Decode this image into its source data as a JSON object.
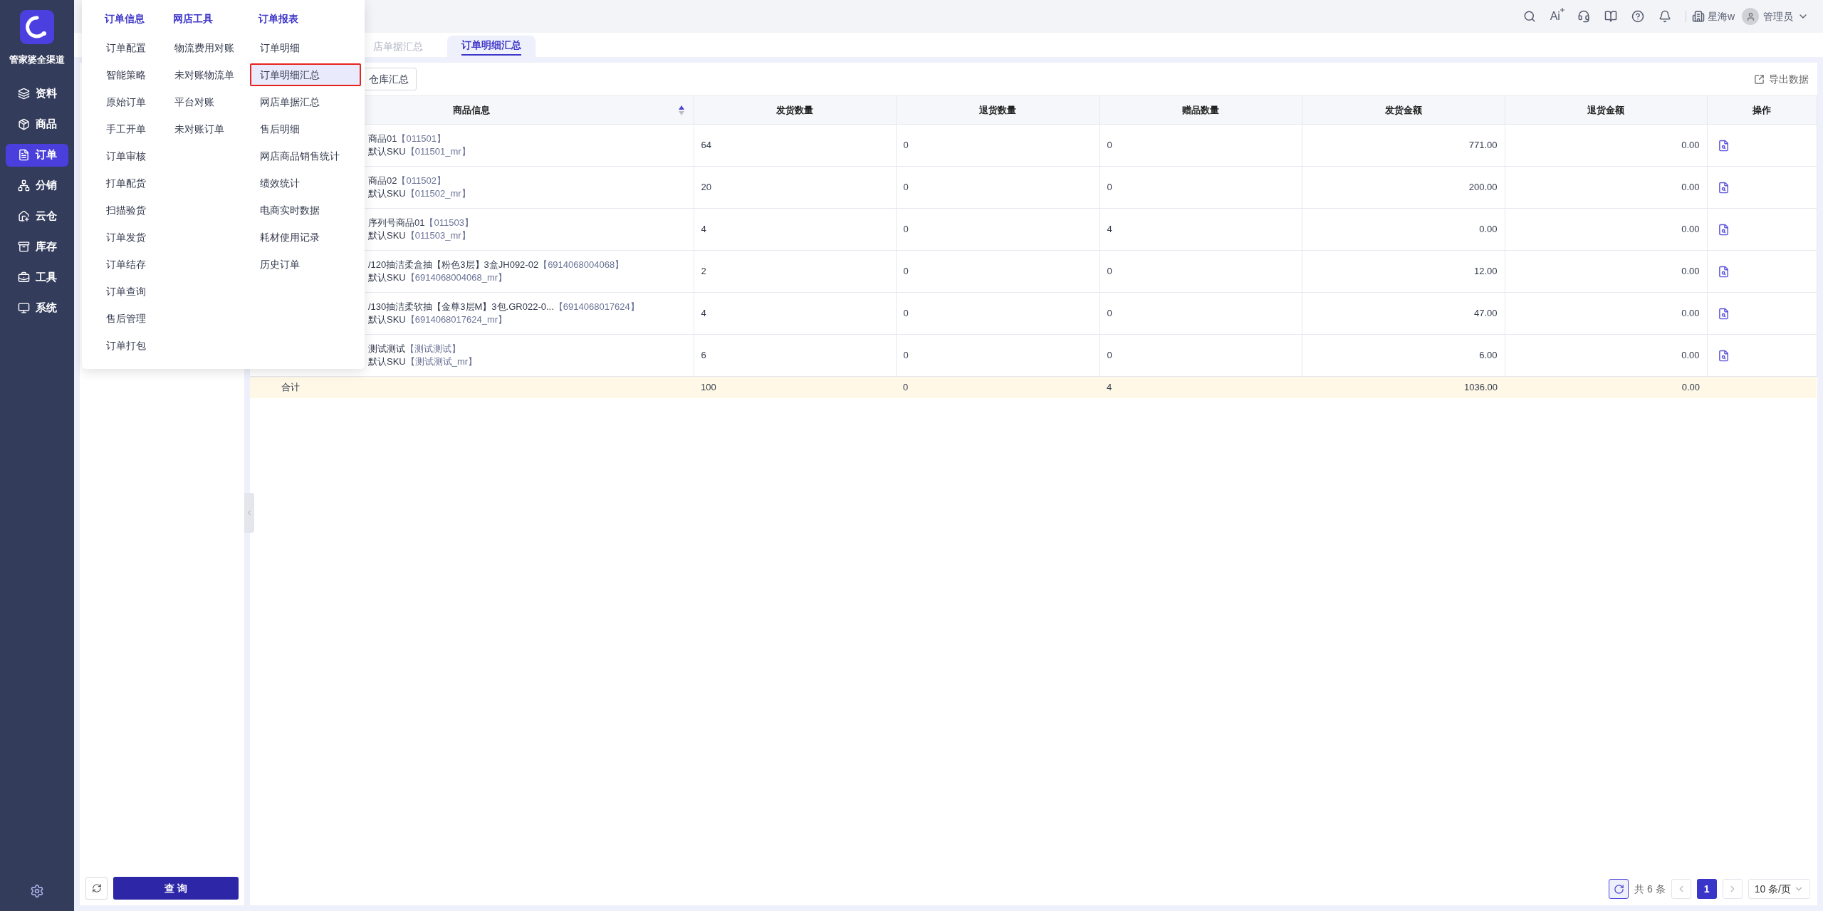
{
  "app": {
    "name": "管家婆全渠道"
  },
  "nav": [
    {
      "label": "资料",
      "selected": false
    },
    {
      "label": "商品",
      "selected": false
    },
    {
      "label": "订单",
      "selected": true
    },
    {
      "label": "分销",
      "selected": false
    },
    {
      "label": "云仓",
      "selected": false
    },
    {
      "label": "库存",
      "selected": false
    },
    {
      "label": "工具",
      "selected": false
    },
    {
      "label": "系统",
      "selected": false
    }
  ],
  "header": {
    "ai_label": "Ai",
    "store": "星海w",
    "user": "管理员"
  },
  "menu": {
    "columns": [
      {
        "title": "订单信息",
        "items": [
          {
            "label": "订单配置",
            "selected": false
          },
          {
            "label": "智能策略",
            "selected": false
          },
          {
            "label": "原始订单",
            "selected": false
          },
          {
            "label": "手工开单",
            "selected": false
          },
          {
            "label": "订单审核",
            "selected": false
          },
          {
            "label": "打单配货",
            "selected": false
          },
          {
            "label": "扫描验货",
            "selected": false
          },
          {
            "label": "订单发货",
            "selected": false
          },
          {
            "label": "订单结存",
            "selected": false
          },
          {
            "label": "订单查询",
            "selected": false
          },
          {
            "label": "售后管理",
            "selected": false
          },
          {
            "label": "订单打包",
            "selected": false
          }
        ]
      },
      {
        "title": "网店工具",
        "items": [
          {
            "label": "物流费用对账",
            "selected": false
          },
          {
            "label": "未对账物流单",
            "selected": false
          },
          {
            "label": "平台对账",
            "selected": false
          },
          {
            "label": "未对账订单",
            "selected": false
          }
        ]
      },
      {
        "title": "订单报表",
        "items": [
          {
            "label": "订单明细",
            "selected": false
          },
          {
            "label": "订单明细汇总",
            "selected": true
          },
          {
            "label": "网店单据汇总",
            "selected": false
          },
          {
            "label": "售后明细",
            "selected": false
          },
          {
            "label": "网店商品销售统计",
            "selected": false
          },
          {
            "label": "绩效统计",
            "selected": false
          },
          {
            "label": "电商实时数据",
            "selected": false
          },
          {
            "label": "耗材使用记录",
            "selected": false
          },
          {
            "label": "历史订单",
            "selected": false
          }
        ]
      }
    ]
  },
  "tabs": [
    {
      "label": "店单据汇总",
      "selected": false
    },
    {
      "label": "订单明细汇总",
      "selected": true
    }
  ],
  "filter_panel": {
    "query_button": "查 询"
  },
  "toolbar": {
    "group_button": "仓库汇总",
    "export": "导出数据"
  },
  "table": {
    "columns": [
      "商品信息",
      "发货数量",
      "退货数量",
      "赠品数量",
      "发货金额",
      "退货金额",
      "操作"
    ],
    "rows": [
      {
        "name": "商品01",
        "code": "【011501】",
        "sku_label": "默认SKU",
        "sku_code": "【011501_mr】",
        "shipped": "64",
        "returned": "0",
        "gift": "0",
        "ship_amount": "771.00",
        "return_amount": "0.00"
      },
      {
        "name": "商品02",
        "code": "【011502】",
        "sku_label": "默认SKU",
        "sku_code": "【011502_mr】",
        "shipped": "20",
        "returned": "0",
        "gift": "0",
        "ship_amount": "200.00",
        "return_amount": "0.00"
      },
      {
        "name": "序列号商品01",
        "code": "【011503】",
        "sku_label": "默认SKU",
        "sku_code": "【011503_mr】",
        "shipped": "4",
        "returned": "0",
        "gift": "4",
        "ship_amount": "0.00",
        "return_amount": "0.00"
      },
      {
        "name": "/120抽洁柔盒抽【粉色3层】3盒JH092-02",
        "code": "【6914068004068】",
        "sku_label": "默认SKU",
        "sku_code": "【6914068004068_mr】",
        "shipped": "2",
        "returned": "0",
        "gift": "0",
        "ship_amount": "12.00",
        "return_amount": "0.00"
      },
      {
        "name": "/130抽洁柔软抽【金尊3层M】3包.GR022-0...",
        "code": "【6914068017624】",
        "sku_label": "默认SKU",
        "sku_code": "【6914068017624_mr】",
        "shipped": "4",
        "returned": "0",
        "gift": "0",
        "ship_amount": "47.00",
        "return_amount": "0.00"
      },
      {
        "name": "测试测试",
        "code": "【测试测试】",
        "sku_label": "默认SKU",
        "sku_code": "【测试测试_mr】",
        "shipped": "6",
        "returned": "0",
        "gift": "0",
        "ship_amount": "6.00",
        "return_amount": "0.00"
      }
    ],
    "summary": {
      "label": "合计",
      "shipped": "100",
      "returned": "0",
      "gift": "4",
      "ship_amount": "1036.00",
      "return_amount": "0.00"
    }
  },
  "pagination": {
    "total": "共 6 条",
    "pages": [
      {
        "label": "1",
        "selected": true
      }
    ],
    "page_size": "10 条/页"
  }
}
